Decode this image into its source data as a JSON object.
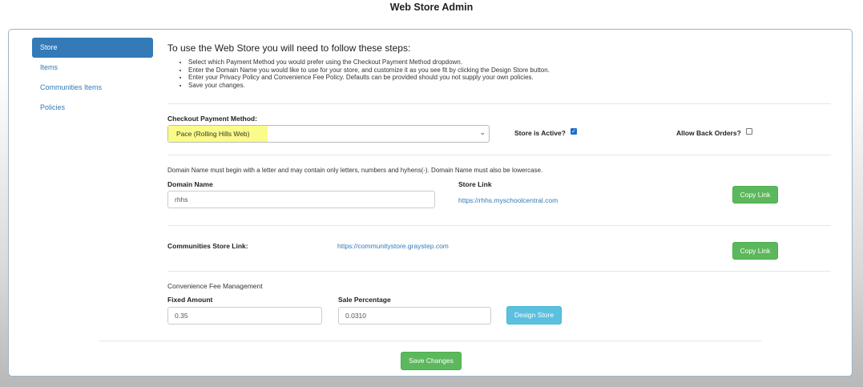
{
  "page_title": "Web Store Admin",
  "nav": [
    {
      "label": "Store",
      "active": true
    },
    {
      "label": "Items",
      "active": false
    },
    {
      "label": "Communities Items",
      "active": false
    },
    {
      "label": "Policies",
      "active": false
    }
  ],
  "intro": {
    "heading": "To use the Web Store you will need to follow these steps:",
    "steps": [
      "Select which Payment Method you would prefer using the Checkout Payment Method dropdown.",
      "Enter the Domain Name you would like to use for your store, and customize it as you see fit by clicking the Design Store button.",
      "Enter your Privacy Policy and Convenience Fee Policy. Defaults can be provided should you not supply your own policies.",
      "Save your changes."
    ]
  },
  "payment": {
    "label": "Checkout Payment Method:",
    "selected": "Pace (Rolling Hills Web)",
    "store_active_label": "Store is Active?",
    "store_active_checked": true,
    "back_orders_label": "Allow Back Orders?",
    "back_orders_checked": false
  },
  "domain": {
    "note": "Domain Name must begin with a letter and may contain only letters, numbers and hyhens(-). Domain Name must also be lowercase.",
    "label": "Domain Name",
    "value": "rhhs",
    "store_link_label": "Store Link",
    "store_link": "https://rhhs.myschoolcentral.com",
    "copy_label": "Copy Link"
  },
  "communities": {
    "label": "Communities Store Link:",
    "link": "https://communitystore.graystep.com",
    "copy_label": "Copy Link"
  },
  "fees": {
    "section_label": "Convenience Fee Management",
    "fixed_label": "Fixed Amount",
    "fixed_value": "0.35",
    "sale_label": "Sale Percentage",
    "sale_value": "0.0310",
    "design_label": "Design Store"
  },
  "save_label": "Save Changes",
  "colors": {
    "primary": "#337ab7",
    "success": "#5cb85c",
    "info": "#5bc0de",
    "highlight": "#fbfb8a"
  }
}
